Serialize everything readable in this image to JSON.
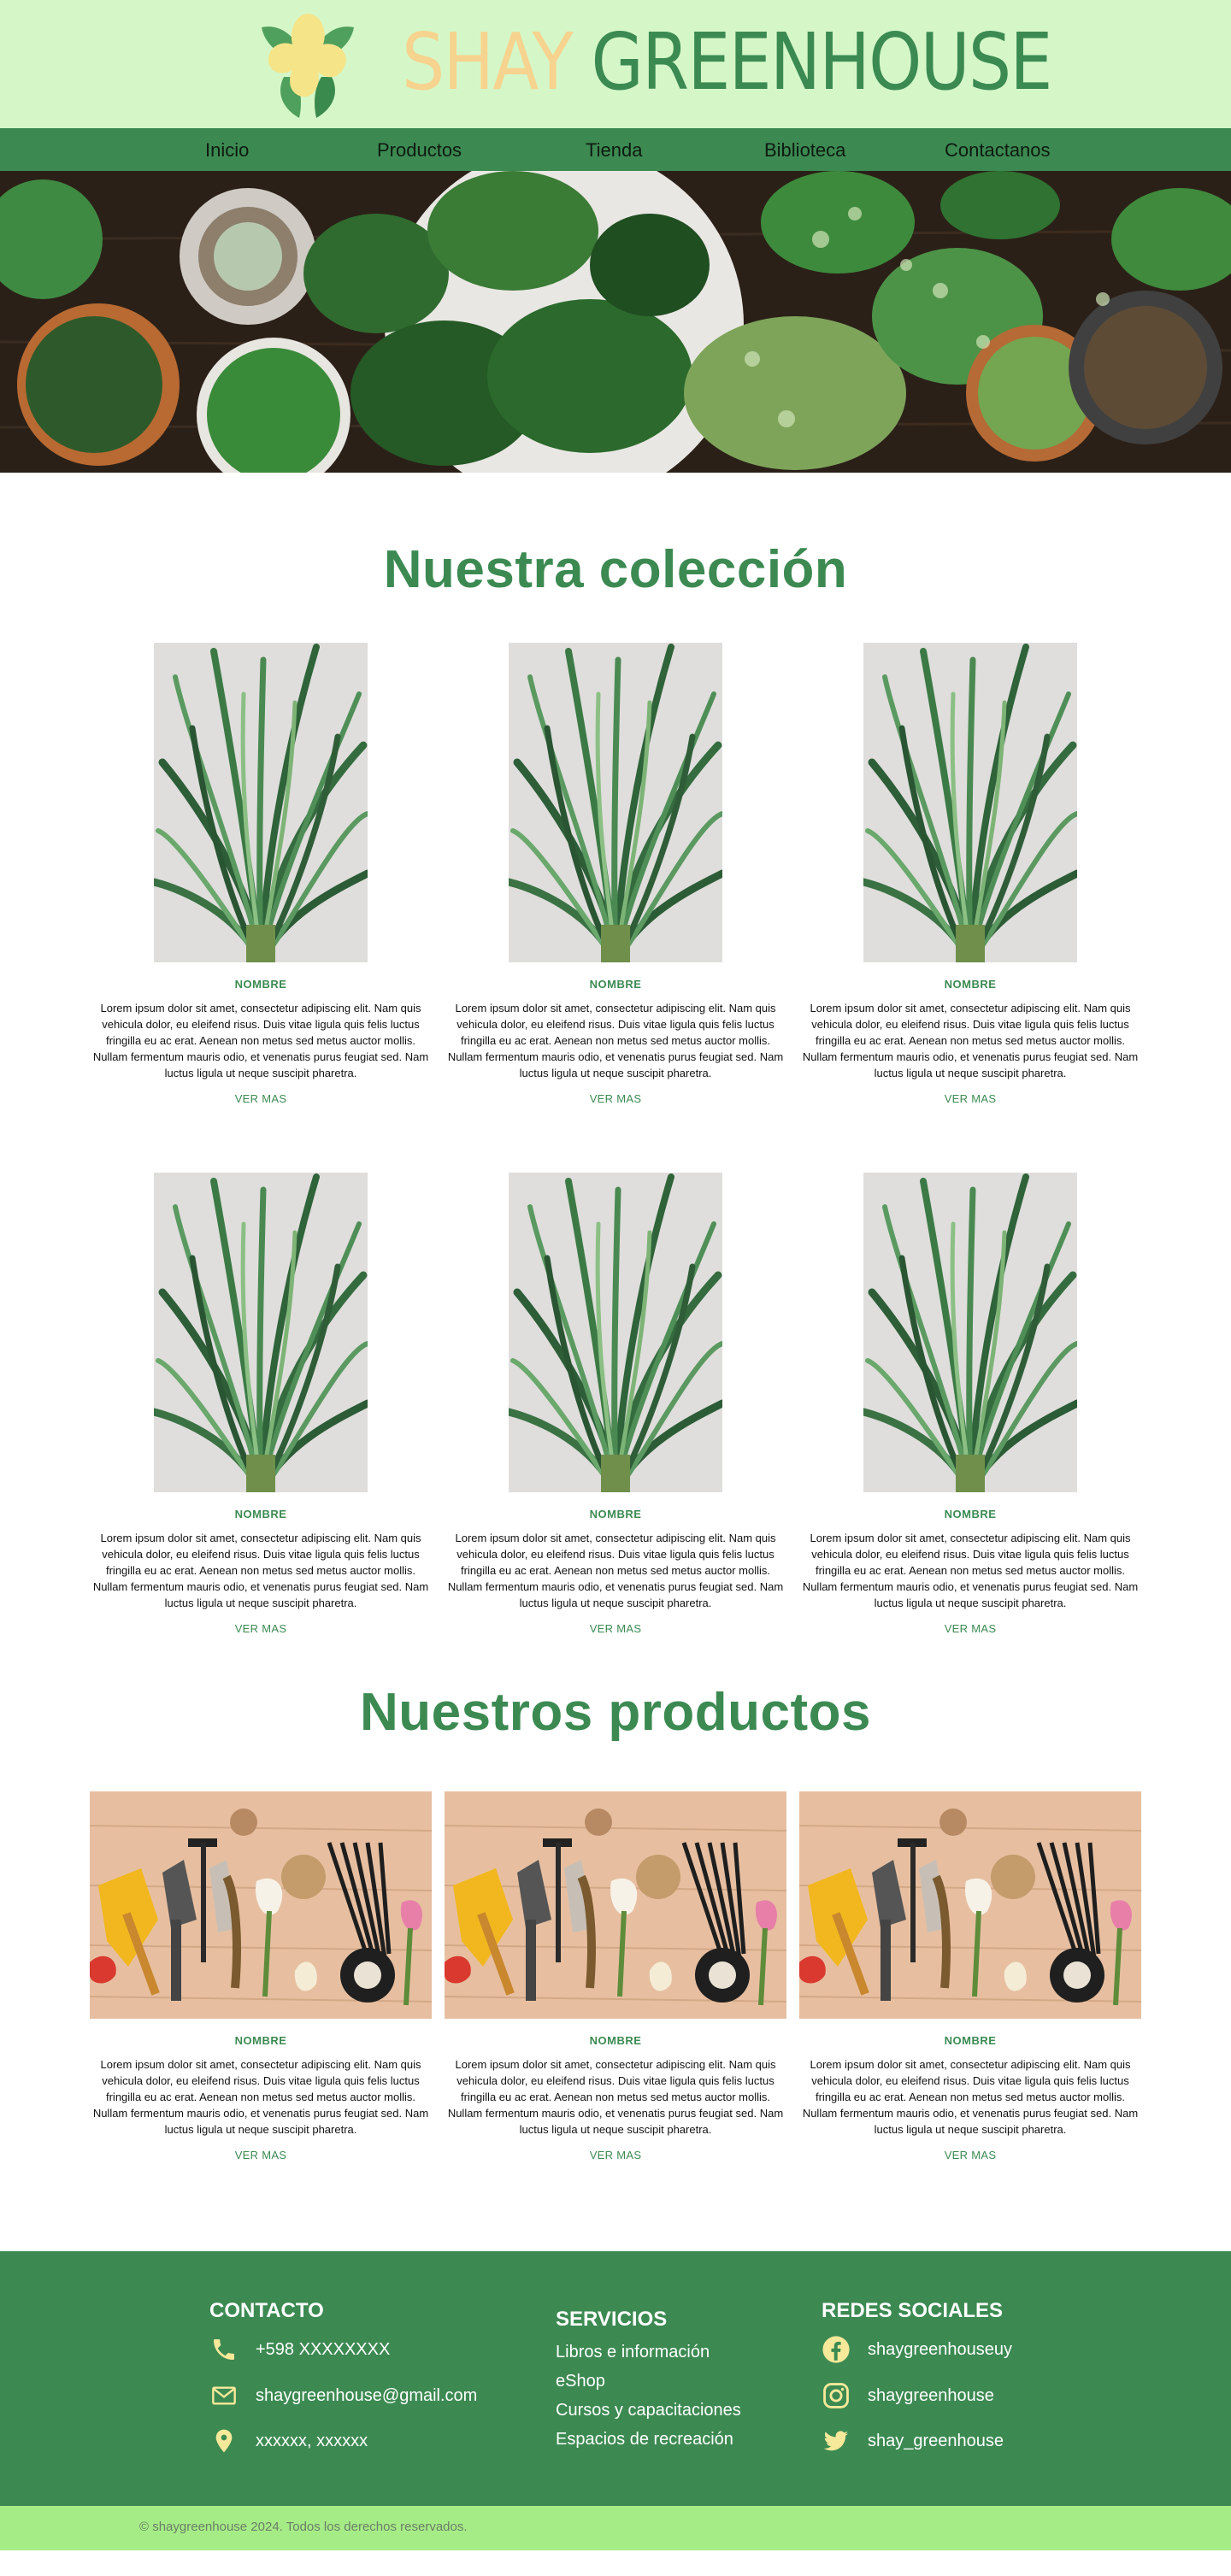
{
  "brand": {
    "first": "SHAY",
    "second": "GREENHOUSE"
  },
  "nav": [
    "Inicio",
    "Productos",
    "Tienda",
    "Biblioteca",
    "Contactanos"
  ],
  "collection": {
    "title": "Nuestra colección",
    "items": [
      {
        "name": "NOMBRE",
        "desc": "Lorem ipsum dolor sit amet, consectetur adipiscing elit. Nam quis vehicula dolor, eu eleifend risus. Duis vitae ligula quis felis luctus fringilla eu ac erat. Aenean non metus sed metus auctor mollis. Nullam fermentum mauris odio, et venenatis purus feugiat sed. Nam luctus ligula ut neque suscipit pharetra.",
        "more": "VER MAS"
      },
      {
        "name": "NOMBRE",
        "desc": "Lorem ipsum dolor sit amet, consectetur adipiscing elit. Nam quis vehicula dolor, eu eleifend risus. Duis vitae ligula quis felis luctus fringilla eu ac erat. Aenean non metus sed metus auctor mollis. Nullam fermentum mauris odio, et venenatis purus feugiat sed. Nam luctus ligula ut neque suscipit pharetra.",
        "more": "VER MAS"
      },
      {
        "name": "NOMBRE",
        "desc": "Lorem ipsum dolor sit amet, consectetur adipiscing elit. Nam quis vehicula dolor, eu eleifend risus. Duis vitae ligula quis felis luctus fringilla eu ac erat. Aenean non metus sed metus auctor mollis. Nullam fermentum mauris odio, et venenatis purus feugiat sed. Nam luctus ligula ut neque suscipit pharetra.",
        "more": "VER MAS"
      },
      {
        "name": "NOMBRE",
        "desc": "Lorem ipsum dolor sit amet, consectetur adipiscing elit. Nam quis vehicula dolor, eu eleifend risus. Duis vitae ligula quis felis luctus fringilla eu ac erat. Aenean non metus sed metus auctor mollis. Nullam fermentum mauris odio, et venenatis purus feugiat sed. Nam luctus ligula ut neque suscipit pharetra.",
        "more": "VER MAS"
      },
      {
        "name": "NOMBRE",
        "desc": "Lorem ipsum dolor sit amet, consectetur adipiscing elit. Nam quis vehicula dolor, eu eleifend risus. Duis vitae ligula quis felis luctus fringilla eu ac erat. Aenean non metus sed metus auctor mollis. Nullam fermentum mauris odio, et venenatis purus feugiat sed. Nam luctus ligula ut neque suscipit pharetra.",
        "more": "VER MAS"
      },
      {
        "name": "NOMBRE",
        "desc": "Lorem ipsum dolor sit amet, consectetur adipiscing elit. Nam quis vehicula dolor, eu eleifend risus. Duis vitae ligula quis felis luctus fringilla eu ac erat. Aenean non metus sed metus auctor mollis. Nullam fermentum mauris odio, et venenatis purus feugiat sed. Nam luctus ligula ut neque suscipit pharetra.",
        "more": "VER MAS"
      }
    ]
  },
  "products": {
    "title": "Nuestros productos",
    "items": [
      {
        "name": "NOMBRE",
        "desc": "Lorem ipsum dolor sit amet, consectetur adipiscing elit. Nam quis vehicula dolor, eu eleifend risus. Duis vitae ligula quis felis luctus fringilla eu ac erat. Aenean non metus sed metus auctor mollis. Nullam fermentum mauris odio, et venenatis purus feugiat sed. Nam luctus ligula ut neque suscipit pharetra.",
        "more": "VER MAS"
      },
      {
        "name": "NOMBRE",
        "desc": "Lorem ipsum dolor sit amet, consectetur adipiscing elit. Nam quis vehicula dolor, eu eleifend risus. Duis vitae ligula quis felis luctus fringilla eu ac erat. Aenean non metus sed metus auctor mollis. Nullam fermentum mauris odio, et venenatis purus feugiat sed. Nam luctus ligula ut neque suscipit pharetra.",
        "more": "VER MAS"
      },
      {
        "name": "NOMBRE",
        "desc": "Lorem ipsum dolor sit amet, consectetur adipiscing elit. Nam quis vehicula dolor, eu eleifend risus. Duis vitae ligula quis felis luctus fringilla eu ac erat. Aenean non metus sed metus auctor mollis. Nullam fermentum mauris odio, et venenatis purus feugiat sed. Nam luctus ligula ut neque suscipit pharetra.",
        "more": "VER MAS"
      }
    ]
  },
  "footer": {
    "contact": {
      "title": "CONTACTO",
      "phone": "+598 XXXXXXXX",
      "email": "shaygreenhouse@gmail.com",
      "location": "xxxxxx, xxxxxx"
    },
    "services": {
      "title": "SERVICIOS",
      "links": [
        "Libros e información",
        "eShop",
        "Cursos y capacitaciones",
        "Espacios de recreación"
      ]
    },
    "social": {
      "title": "REDES SOCIALES",
      "facebook": "shaygreenhouseuy",
      "instagram": "shaygreenhouse",
      "twitter": "shay_greenhouse"
    },
    "copyright": "© shaygreenhouse 2024. Todos los derechos reservados."
  },
  "colors": {
    "header_bg": "#d5f7c8",
    "primary_green": "#3c8a52",
    "brand_yellow": "#f6d38e",
    "copyright_bg": "#a6ec86",
    "icon_yellow": "#f6e99a"
  },
  "icons": [
    "logo-flower",
    "phone-icon",
    "mail-icon",
    "location-pin-icon",
    "facebook-icon",
    "instagram-icon",
    "twitter-icon"
  ]
}
